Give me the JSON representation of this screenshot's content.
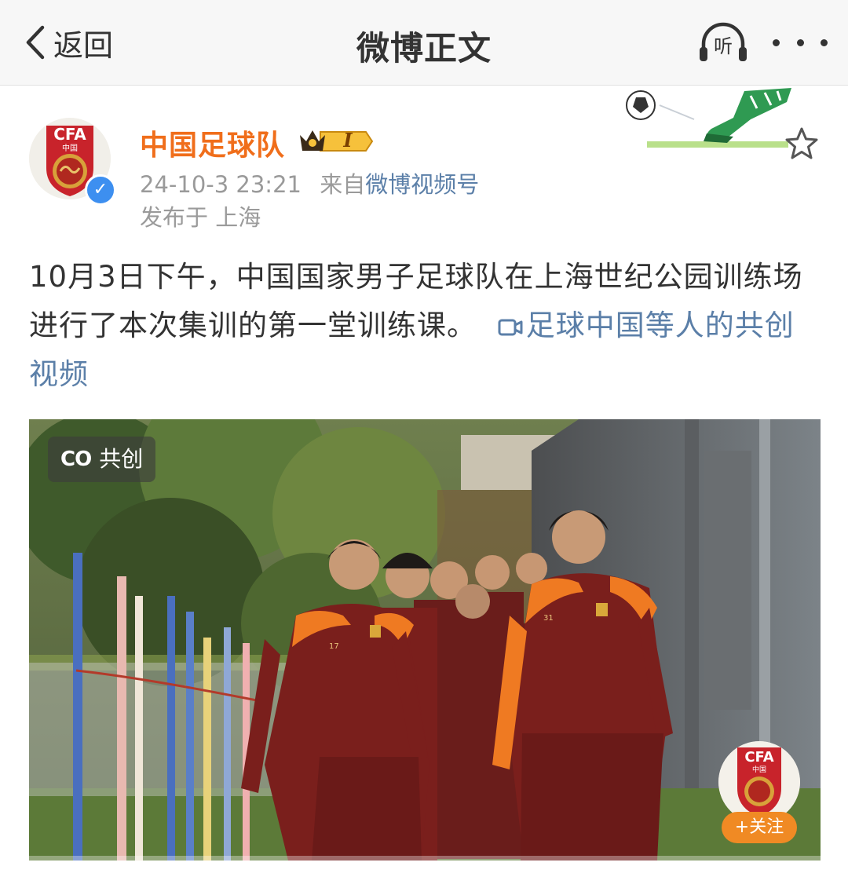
{
  "header": {
    "back_label": "返回",
    "title": "微博正文",
    "listen_label": "听"
  },
  "post": {
    "author": "中国足球队",
    "avatar_text": "CFA",
    "avatar_sub": "中国",
    "verified_mark": "✓",
    "vip_level": "I",
    "time": "24-10-3 23:21",
    "source_prefix": "来自",
    "source": "微博视频号",
    "location": "发布于 上海",
    "text": "10月3日下午，中国国家男子足球队在上海世纪公园训练场进行了本次集训的第一堂训练课。",
    "video_link": "足球中国等人的共创视频"
  },
  "video": {
    "co_mark": "CO",
    "co_label": "共创",
    "follow_label": "+关注",
    "logo_text": "CFA",
    "logo_sub": "中国",
    "jersey_numbers": [
      "17",
      "31"
    ]
  },
  "colors": {
    "author": "#f06e1b",
    "link": "#5b7fa8",
    "meta": "#9a9a9a",
    "follow": "#f08a24",
    "jersey": "#7a1f1c",
    "jersey_trim": "#ef7a22"
  }
}
